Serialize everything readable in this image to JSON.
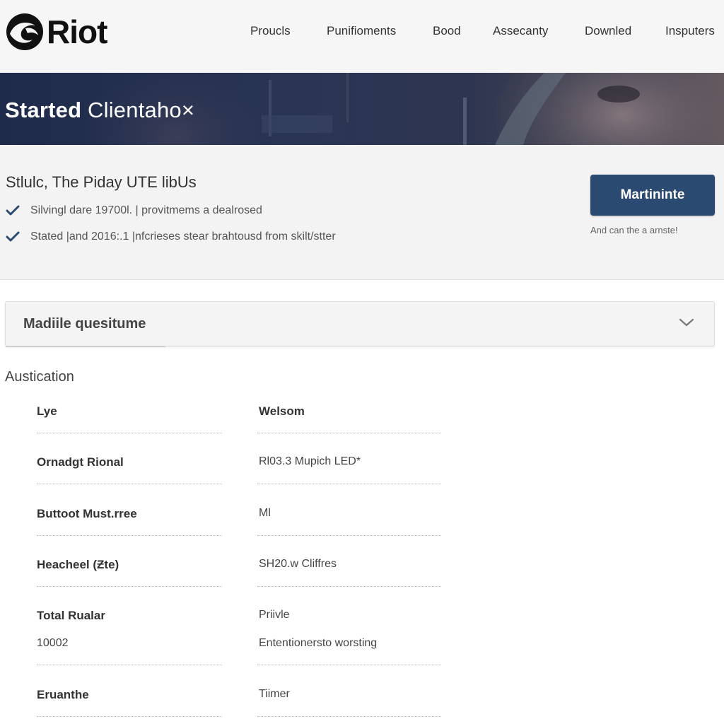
{
  "header": {
    "logo_text": "Riot",
    "nav": [
      "Proucls",
      "Punifioments",
      "Bood",
      "Assecanty",
      "Downled",
      "Insputers"
    ]
  },
  "hero": {
    "title_bold": "Started",
    "title_light": "Clientaho×"
  },
  "info": {
    "heading": "Stlulc, The Piday UTE libUs",
    "bullets": [
      "Silvingl dare 19700l. | provitmems a dealrosed",
      "Stated |and 2016:.1 |nfcrieses stear brahtousd from skilt/stter"
    ],
    "cta_label": "Martininte",
    "cta_note": "And can the a arnste!"
  },
  "accordion": {
    "title": "Madiile quesitume"
  },
  "specs": {
    "title": "Austication",
    "rows": [
      {
        "label": "Lye",
        "value": "Welsom"
      },
      {
        "label": "Ornadgt Rional",
        "value": "Rl03.3 Mupich LED*"
      },
      {
        "label": "Buttoot Must.rree",
        "value": "Ml"
      },
      {
        "label": "Heacheel (Ƶte)",
        "value": "SH20.w Cliffres"
      },
      {
        "label": "Total Rualar",
        "sub": "10002",
        "value": "Priivle",
        "value2": "Ententionersto worsting"
      },
      {
        "label": "Eruanthe",
        "value": "Tiimer"
      }
    ]
  },
  "colors": {
    "accent": "#2b4a72",
    "check": "#2b4a72",
    "hero_bg": "#1f2b4a"
  },
  "icons": {
    "logo": "riot-logo-icon",
    "check": "check-icon",
    "chevron": "chevron-down-icon"
  }
}
